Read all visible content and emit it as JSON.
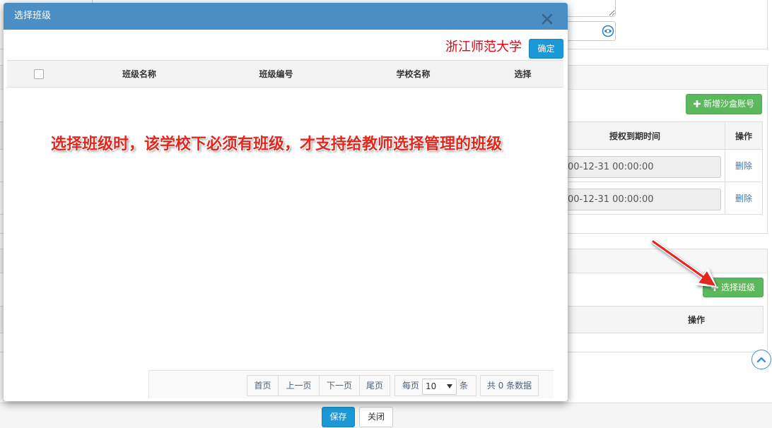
{
  "modal": {
    "title": "选择班级",
    "school_name": "浙江师范大学",
    "confirm_label": "确定",
    "table": {
      "columns": [
        "班级名称",
        "班级编号",
        "学校名称",
        "选择"
      ],
      "rows": []
    },
    "pagination": {
      "first_label": "首页",
      "prev_label": "上一页",
      "next_label": "下一页",
      "last_label": "尾页",
      "per_page_prefix": "每页",
      "per_page_value": "10",
      "per_page_suffix": "条",
      "total_text": "共 0 条数据"
    }
  },
  "annotation": {
    "note": "选择班级时，该学校下必须有班级，才支持给教师选择管理的班级"
  },
  "background": {
    "sandbox_panel": {
      "add_button_label": "新增沙盒账号",
      "columns": [
        "授权到期时间",
        "操作"
      ],
      "rows": [
        {
          "expiry": "00-12-31 00:00:00",
          "action": "删除"
        },
        {
          "expiry": "00-12-31 00:00:00",
          "action": "删除"
        }
      ]
    },
    "class_panel": {
      "select_button_label": "选择班级",
      "columns": [
        "操作"
      ]
    }
  },
  "footer": {
    "save_label": "保存",
    "close_label": "关闭"
  },
  "icons": {
    "modal_close": "close-icon",
    "password_toggle": "eye-icon",
    "button_plus": "plus-icon",
    "select_caret": "caret-down-icon",
    "scroll_top": "chevron-up-icon"
  },
  "colors": {
    "modal_header": "#4b8ec3",
    "primary_button": "#1b98d5",
    "success_button": "#5cb85c",
    "annotation_red": "#e5261c",
    "school_name": "#e60012",
    "link": "#337ab7"
  }
}
